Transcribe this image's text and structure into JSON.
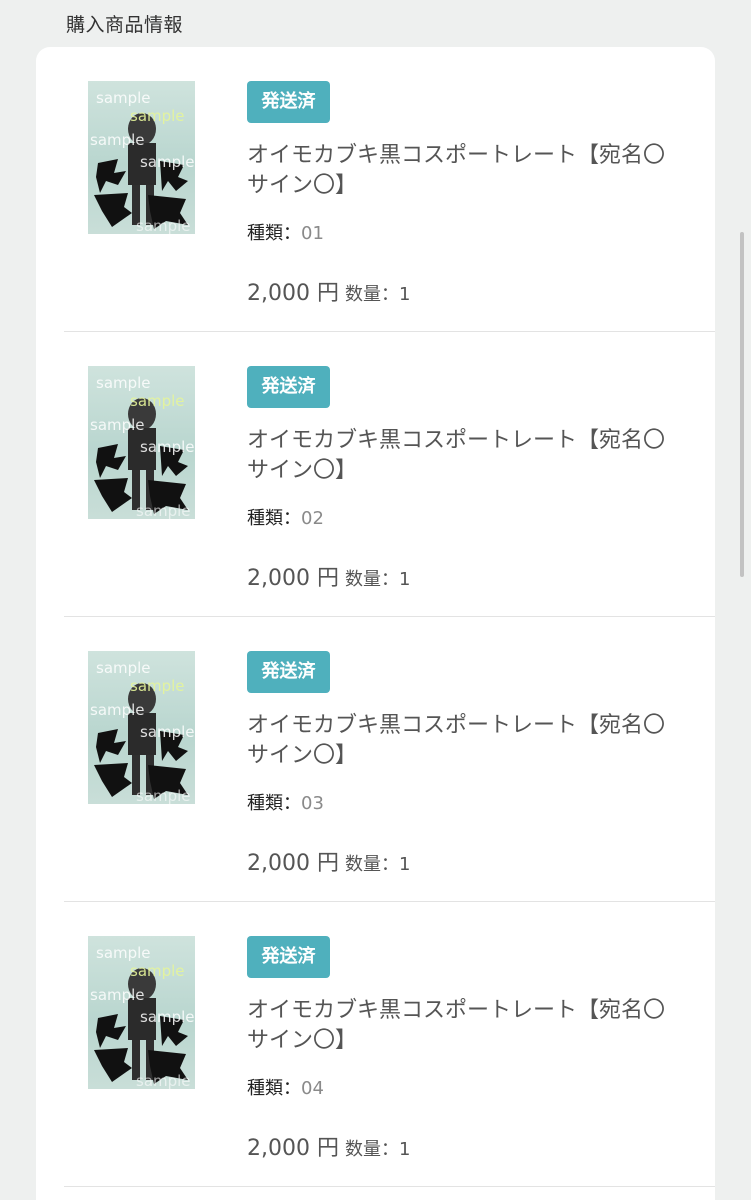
{
  "section_title": "購入商品情報",
  "items": [
    {
      "status": "発送済",
      "name": "オイモカブキ黒コスポートレート【宛名〇 サイン〇】",
      "kind_label": "種類：",
      "kind_value": "01",
      "price": "2,000 円",
      "qty_label": "数量：",
      "qty_value": "1",
      "thumb_text": [
        "sample",
        "sample",
        "sample",
        "sample",
        "sample"
      ]
    },
    {
      "status": "発送済",
      "name": "オイモカブキ黒コスポートレート【宛名〇 サイン〇】",
      "kind_label": "種類：",
      "kind_value": "02",
      "price": "2,000 円",
      "qty_label": "数量：",
      "qty_value": "1",
      "thumb_text": [
        "sample",
        "sample",
        "sample",
        "sample",
        "sample"
      ]
    },
    {
      "status": "発送済",
      "name": "オイモカブキ黒コスポートレート【宛名〇 サイン〇】",
      "kind_label": "種類：",
      "kind_value": "03",
      "price": "2,000 円",
      "qty_label": "数量：",
      "qty_value": "1",
      "thumb_text": [
        "sample",
        "sample",
        "sample",
        "sample",
        "sample"
      ]
    },
    {
      "status": "発送済",
      "name": "オイモカブキ黒コスポートレート【宛名〇 サイン〇】",
      "kind_label": "種類：",
      "kind_value": "04",
      "price": "2,000 円",
      "qty_label": "数量：",
      "qty_value": "1",
      "thumb_text": [
        "sample",
        "sample",
        "sample",
        "sample",
        "sample"
      ]
    }
  ],
  "colors": {
    "background": "#eef0ef",
    "card": "#ffffff",
    "badge": "#4fb0bd",
    "divider": "#e3e3e3"
  }
}
